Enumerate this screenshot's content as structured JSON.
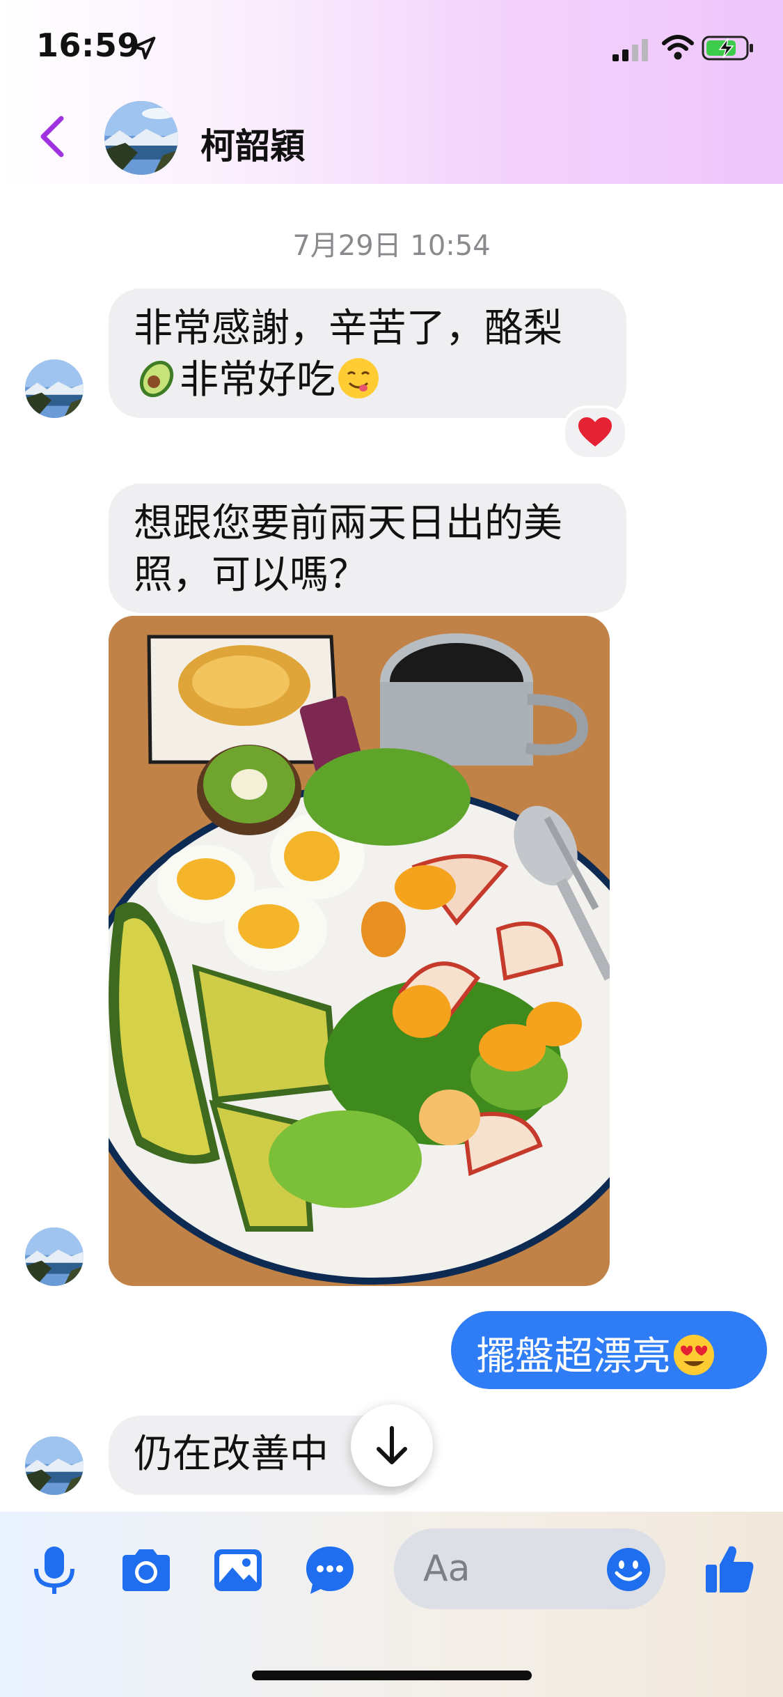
{
  "status_bar": {
    "time": "16:59"
  },
  "header": {
    "contact_name": "柯韶穎"
  },
  "conversation": {
    "date_stamp": "7月29日 10:54",
    "messages": [
      {
        "line1": "非常感謝，辛苦了，酪梨",
        "line2": "非常好吃",
        "reaction": "heart"
      },
      {
        "line1": "想跟您要前兩天日出的美",
        "line2": "照，可以嗎？"
      },
      {
        "type": "photo"
      },
      {
        "outgoing": "擺盤超漂亮"
      },
      {
        "text": "仍在改善中"
      }
    ]
  },
  "composer": {
    "placeholder": "Aa"
  },
  "colors": {
    "accent": "#2e7cf6",
    "back_arrow": "#a033e0",
    "bubble_in": "#efeff1"
  }
}
